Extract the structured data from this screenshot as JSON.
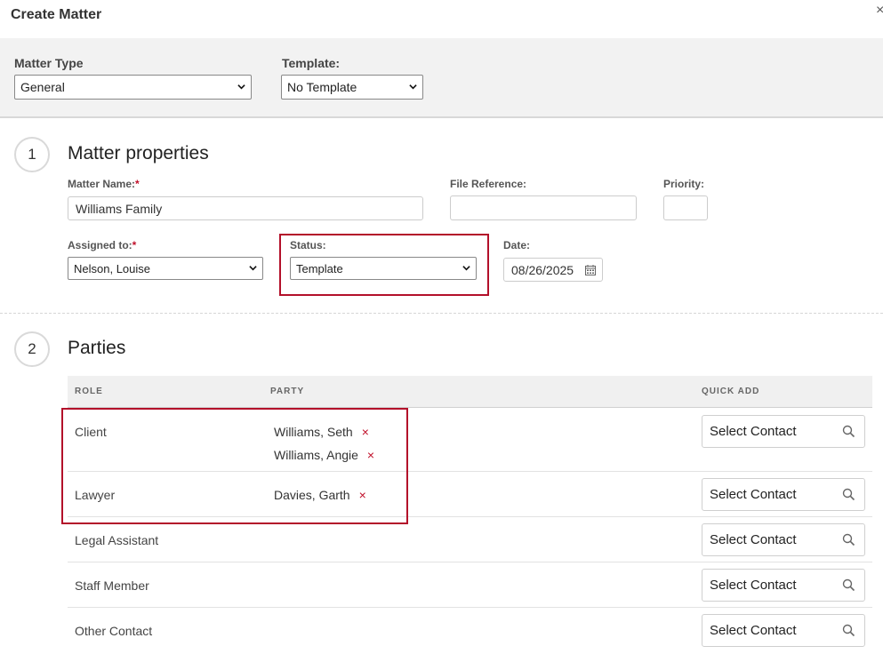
{
  "dialog": {
    "title": "Create Matter",
    "close_glyph": "×"
  },
  "top": {
    "matter_type_label": "Matter Type",
    "matter_type_value": "General",
    "template_label": "Template:",
    "template_value": "No Template"
  },
  "section1": {
    "number": "1",
    "title": "Matter properties",
    "matter_name_label": "Matter Name:",
    "required_mark": "*",
    "matter_name_value": "Williams Family",
    "file_reference_label": "File Reference:",
    "file_reference_value": "",
    "priority_label": "Priority:",
    "priority_value": "",
    "assigned_label": "Assigned to:",
    "assigned_value": "Nelson, Louise",
    "status_label": "Status:",
    "status_value": "Template",
    "date_label": "Date:",
    "date_value": "08/26/2025"
  },
  "section2": {
    "number": "2",
    "title": "Parties",
    "headers": {
      "role": "ROLE",
      "party": "PARTY",
      "quick_add": "QUICK ADD"
    },
    "rows": [
      {
        "role": "Client",
        "parties": [
          "Williams, Seth",
          "Williams, Angie"
        ],
        "quick_add": "Select Contact"
      },
      {
        "role": "Lawyer",
        "parties": [
          "Davies, Garth"
        ],
        "quick_add": "Select Contact"
      },
      {
        "role": "Legal Assistant",
        "parties": [],
        "quick_add": "Select Contact"
      },
      {
        "role": "Staff Member",
        "parties": [],
        "quick_add": "Select Contact"
      },
      {
        "role": "Other Contact",
        "parties": [],
        "quick_add": "Select Contact"
      }
    ],
    "remove_glyph": "×"
  },
  "colors": {
    "accent_red": "#b3102a",
    "band_gray": "#f2f2f2"
  },
  "icons": [
    "close-icon",
    "chevron-down-icon",
    "calendar-icon",
    "search-icon",
    "remove-icon"
  ]
}
